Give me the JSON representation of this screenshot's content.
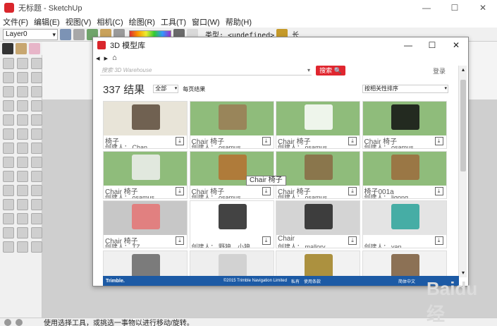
{
  "app": {
    "title": "无标题 - SketchUp",
    "window_controls": [
      "—",
      "☐",
      "✕"
    ]
  },
  "menu": [
    "文件(F)",
    "编辑(E)",
    "视图(V)",
    "相机(C)",
    "绘图(R)",
    "工具(T)",
    "窗口(W)",
    "帮助(H)"
  ],
  "toolbar": {
    "layer": "Layer0",
    "type_label": "类型: <undefined>",
    "length_label": "长"
  },
  "dialog": {
    "title": "3D 模型库",
    "controls": [
      "—",
      "☐",
      "✕"
    ],
    "nav": [
      "◂",
      "▸",
      "⌂"
    ],
    "search_placeholder": "搜索 3D Warehouse",
    "search_button": "搜索 🔍",
    "login": "登录",
    "result_count": "337 结果",
    "filter": "全部",
    "per_page": "每页结果",
    "sort": "按相关性排序",
    "download_glyph": "⤓",
    "models": [
      {
        "title": "椅子",
        "creator": "创建人： Chan",
        "bg": "#e8e4d8",
        "color": "#5a4a3a"
      },
      {
        "title": "Chair  椅子",
        "creator": "创建人： osamus",
        "bg": "#8fbc7b",
        "color": "#9b7b55"
      },
      {
        "title": "Chair  椅子",
        "creator": "创建人： osamus",
        "bg": "#8fbc7b",
        "color": "#ffffff"
      },
      {
        "title": "Chair  椅子",
        "creator": "创建人： osamus",
        "bg": "#8fbc7b",
        "color": "#111111"
      },
      {
        "title": "Chair  椅子",
        "creator": "创建人： osamus",
        "bg": "#8fbc7b",
        "color": "#f0f0f0"
      },
      {
        "title": "Chair  椅子",
        "creator": "创建人： osamus",
        "bg": "#8fbc7b",
        "color": "#b5702f"
      },
      {
        "title": "Chair  椅子",
        "creator": "创建人： osamus",
        "bg": "#8fbc7b",
        "color": "#8a6a44"
      },
      {
        "title": "椅子001a",
        "creator": "创建人： ligong",
        "bg": "#8fbc7b",
        "color": "#9c6b3c"
      },
      {
        "title": "Chair  椅子",
        "creator": "创建人： TZ",
        "bg": "#c7c7c7",
        "color": "#e57373"
      },
      {
        "title": "",
        "creator": "创建人： 野狼，小狼",
        "bg": "#ffffff",
        "color": "#222222"
      },
      {
        "title": "Chair",
        "creator": "创建人： mallory",
        "bg": "#d4d4d4",
        "color": "#222222"
      },
      {
        "title": "",
        "creator": "创建人： yan",
        "bg": "#e4e4e4",
        "color": "#2aa39a"
      },
      {
        "title": "",
        "creator": "",
        "bg": "#f0f0f0",
        "color": "#666666"
      },
      {
        "title": "",
        "creator": "",
        "bg": "#eeeeee",
        "color": "#cccccc"
      },
      {
        "title": "",
        "creator": "",
        "bg": "#f2f2f2",
        "color": "#a08020"
      },
      {
        "title": "",
        "creator": "",
        "bg": "#f2f2f2",
        "color": "#7a5a3a"
      }
    ],
    "footer": {
      "brand": "Trimble.",
      "copyright": "©2015 Trimble Navigation Limited",
      "privacy": "私有",
      "terms": "使用条款",
      "language": "简体中文"
    },
    "tooltip": "Chair 椅子"
  },
  "status": {
    "text": "使用选择工具，或挑选一事物以进行移动/旋转。"
  },
  "watermark": "Baidu 经"
}
